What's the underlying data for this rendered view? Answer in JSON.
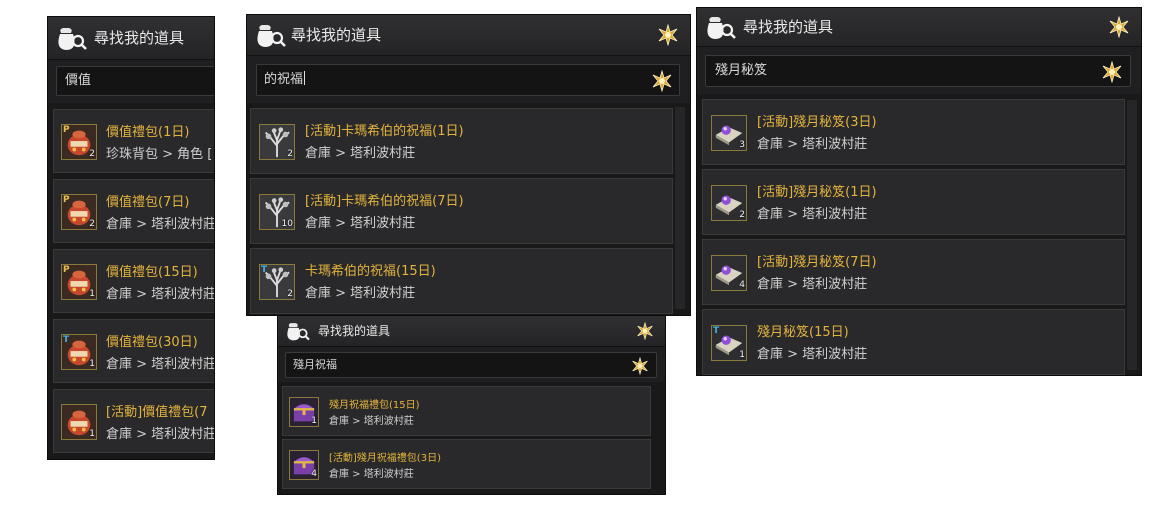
{
  "colors": {
    "panel_bg": "#1f1f21",
    "item_bg": "#29292b",
    "item_name": "#e3b43c",
    "item_location": "#d0d0d0",
    "title_text": "#e9e9e9",
    "badge_p": "#e6c04c",
    "badge_t": "#3fb2e6"
  },
  "panel_a": {
    "title": "尋找我的道具",
    "search_value": "價值",
    "items": [
      {
        "name": "價值禮包(1日)",
        "location": "珍珠背包 > 角色 [",
        "count": "2",
        "badge": "P",
        "icon": "gift-bag-icon"
      },
      {
        "name": "價值禮包(7日)",
        "location": "倉庫 > 塔利波村莊",
        "count": "2",
        "badge": "P",
        "icon": "gift-bag-icon"
      },
      {
        "name": "價值禮包(15日)",
        "location": "倉庫 > 塔利波村莊",
        "count": "1",
        "badge": "P",
        "icon": "gift-bag-icon"
      },
      {
        "name": "價值禮包(30日)",
        "location": "倉庫 > 塔利波村莊",
        "count": "1",
        "badge": "T",
        "icon": "gift-bag-icon"
      },
      {
        "name": "[活動]價值禮包(7",
        "location": "倉庫 > 塔利波村莊",
        "count": "1",
        "badge": "",
        "icon": "gift-bag-icon"
      }
    ]
  },
  "panel_b": {
    "title": "尋找我的道具",
    "search_value": "的祝福",
    "items": [
      {
        "name": "[活動]卡瑪希伯的祝福(1日)",
        "location": "倉庫 > 塔利波村莊",
        "count": "2",
        "badge": "",
        "icon": "blessing-tree-icon"
      },
      {
        "name": "[活動]卡瑪希伯的祝福(7日)",
        "location": "倉庫 > 塔利波村莊",
        "count": "10",
        "badge": "",
        "icon": "blessing-tree-icon"
      },
      {
        "name": "卡瑪希伯的祝福(15日)",
        "location": "倉庫 > 塔利波村莊",
        "count": "2",
        "badge": "T",
        "icon": "blessing-tree-icon"
      }
    ]
  },
  "panel_c": {
    "title": "尋找我的道具",
    "search_value": "殘月祝福",
    "items": [
      {
        "name": "殘月祝福禮包(15日)",
        "location": "倉庫 > 塔利波村莊",
        "count": "1",
        "badge": "",
        "icon": "purple-chest-icon"
      },
      {
        "name": "[活動]殘月祝福禮包(3日)",
        "location": "倉庫 > 塔利波村莊",
        "count": "4",
        "badge": "",
        "icon": "purple-chest-icon"
      }
    ]
  },
  "panel_d": {
    "title": "尋找我的道具",
    "search_value": "殘月秘笈",
    "items": [
      {
        "name": "[活動]殘月秘笈(3日)",
        "location": "倉庫 > 塔利波村莊",
        "count": "3",
        "badge": "",
        "icon": "secret-scroll-icon"
      },
      {
        "name": "[活動]殘月秘笈(1日)",
        "location": "倉庫 > 塔利波村莊",
        "count": "2",
        "badge": "",
        "icon": "secret-scroll-icon"
      },
      {
        "name": "[活動]殘月秘笈(7日)",
        "location": "倉庫 > 塔利波村莊",
        "count": "4",
        "badge": "",
        "icon": "secret-scroll-icon"
      },
      {
        "name": "殘月秘笈(15日)",
        "location": "倉庫 > 塔利波村莊",
        "count": "1",
        "badge": "T",
        "icon": "secret-scroll-icon"
      }
    ]
  }
}
